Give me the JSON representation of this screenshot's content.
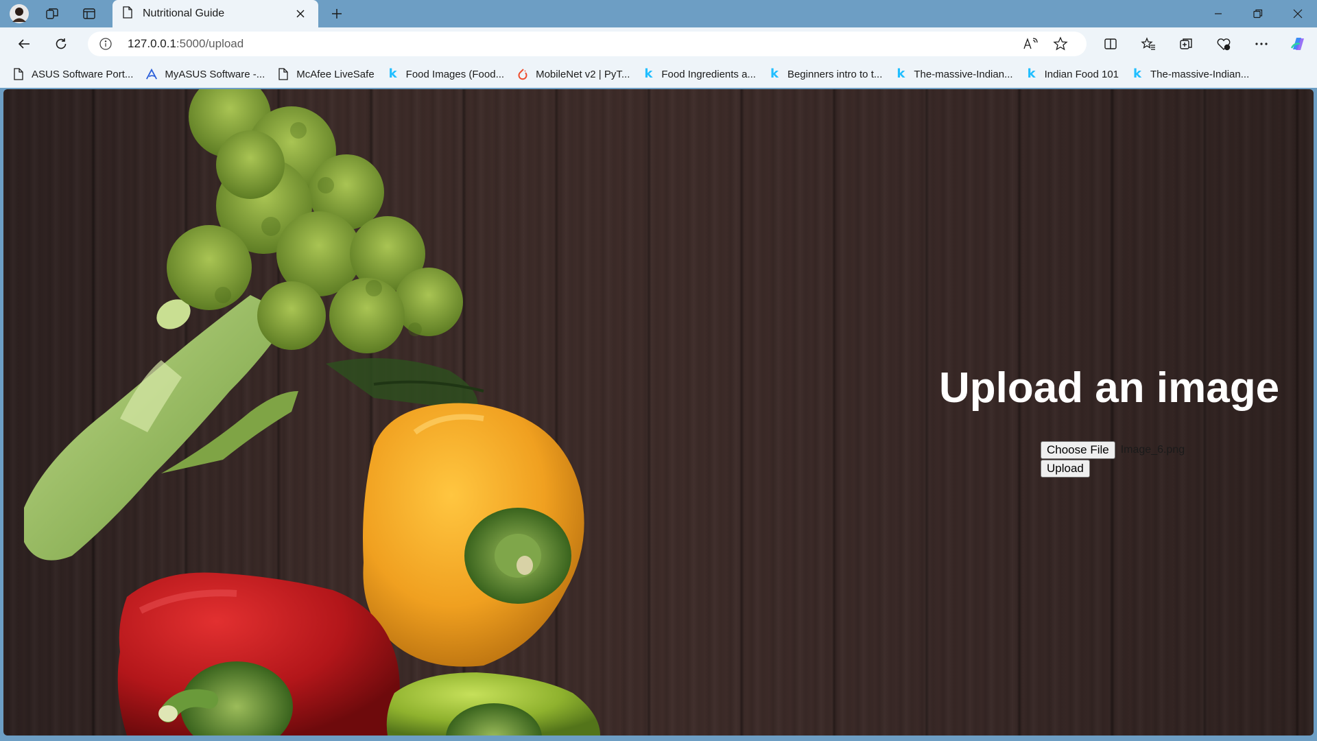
{
  "browser": {
    "tab": {
      "title": "Nutritional Guide"
    },
    "address": {
      "host": "127.0.0.1",
      "path": ":5000/upload"
    },
    "bookmarks": [
      {
        "label": "ASUS Software Port...",
        "icon": "page-icon"
      },
      {
        "label": "MyASUS Software -...",
        "icon": "asus-icon"
      },
      {
        "label": "McAfee LiveSafe",
        "icon": "page-icon"
      },
      {
        "label": "Food Images (Food...",
        "icon": "kaggle-icon"
      },
      {
        "label": "MobileNet v2 | PyT...",
        "icon": "pytorch-icon"
      },
      {
        "label": "Food Ingredients a...",
        "icon": "kaggle-icon"
      },
      {
        "label": "Beginners intro to t...",
        "icon": "kaggle-icon"
      },
      {
        "label": "The-massive-Indian...",
        "icon": "kaggle-icon"
      },
      {
        "label": "Indian Food 101",
        "icon": "kaggle-icon"
      },
      {
        "label": "The-massive-Indian...",
        "icon": "kaggle-icon"
      }
    ],
    "colors": {
      "frame": "#6d9ec4",
      "toolbar": "#eef4f9",
      "kaggle": "#20beff"
    }
  },
  "page": {
    "heading": "Upload an image",
    "choose_file_label": "Choose File",
    "selected_file": "Image_6.png",
    "upload_label": "Upload"
  }
}
